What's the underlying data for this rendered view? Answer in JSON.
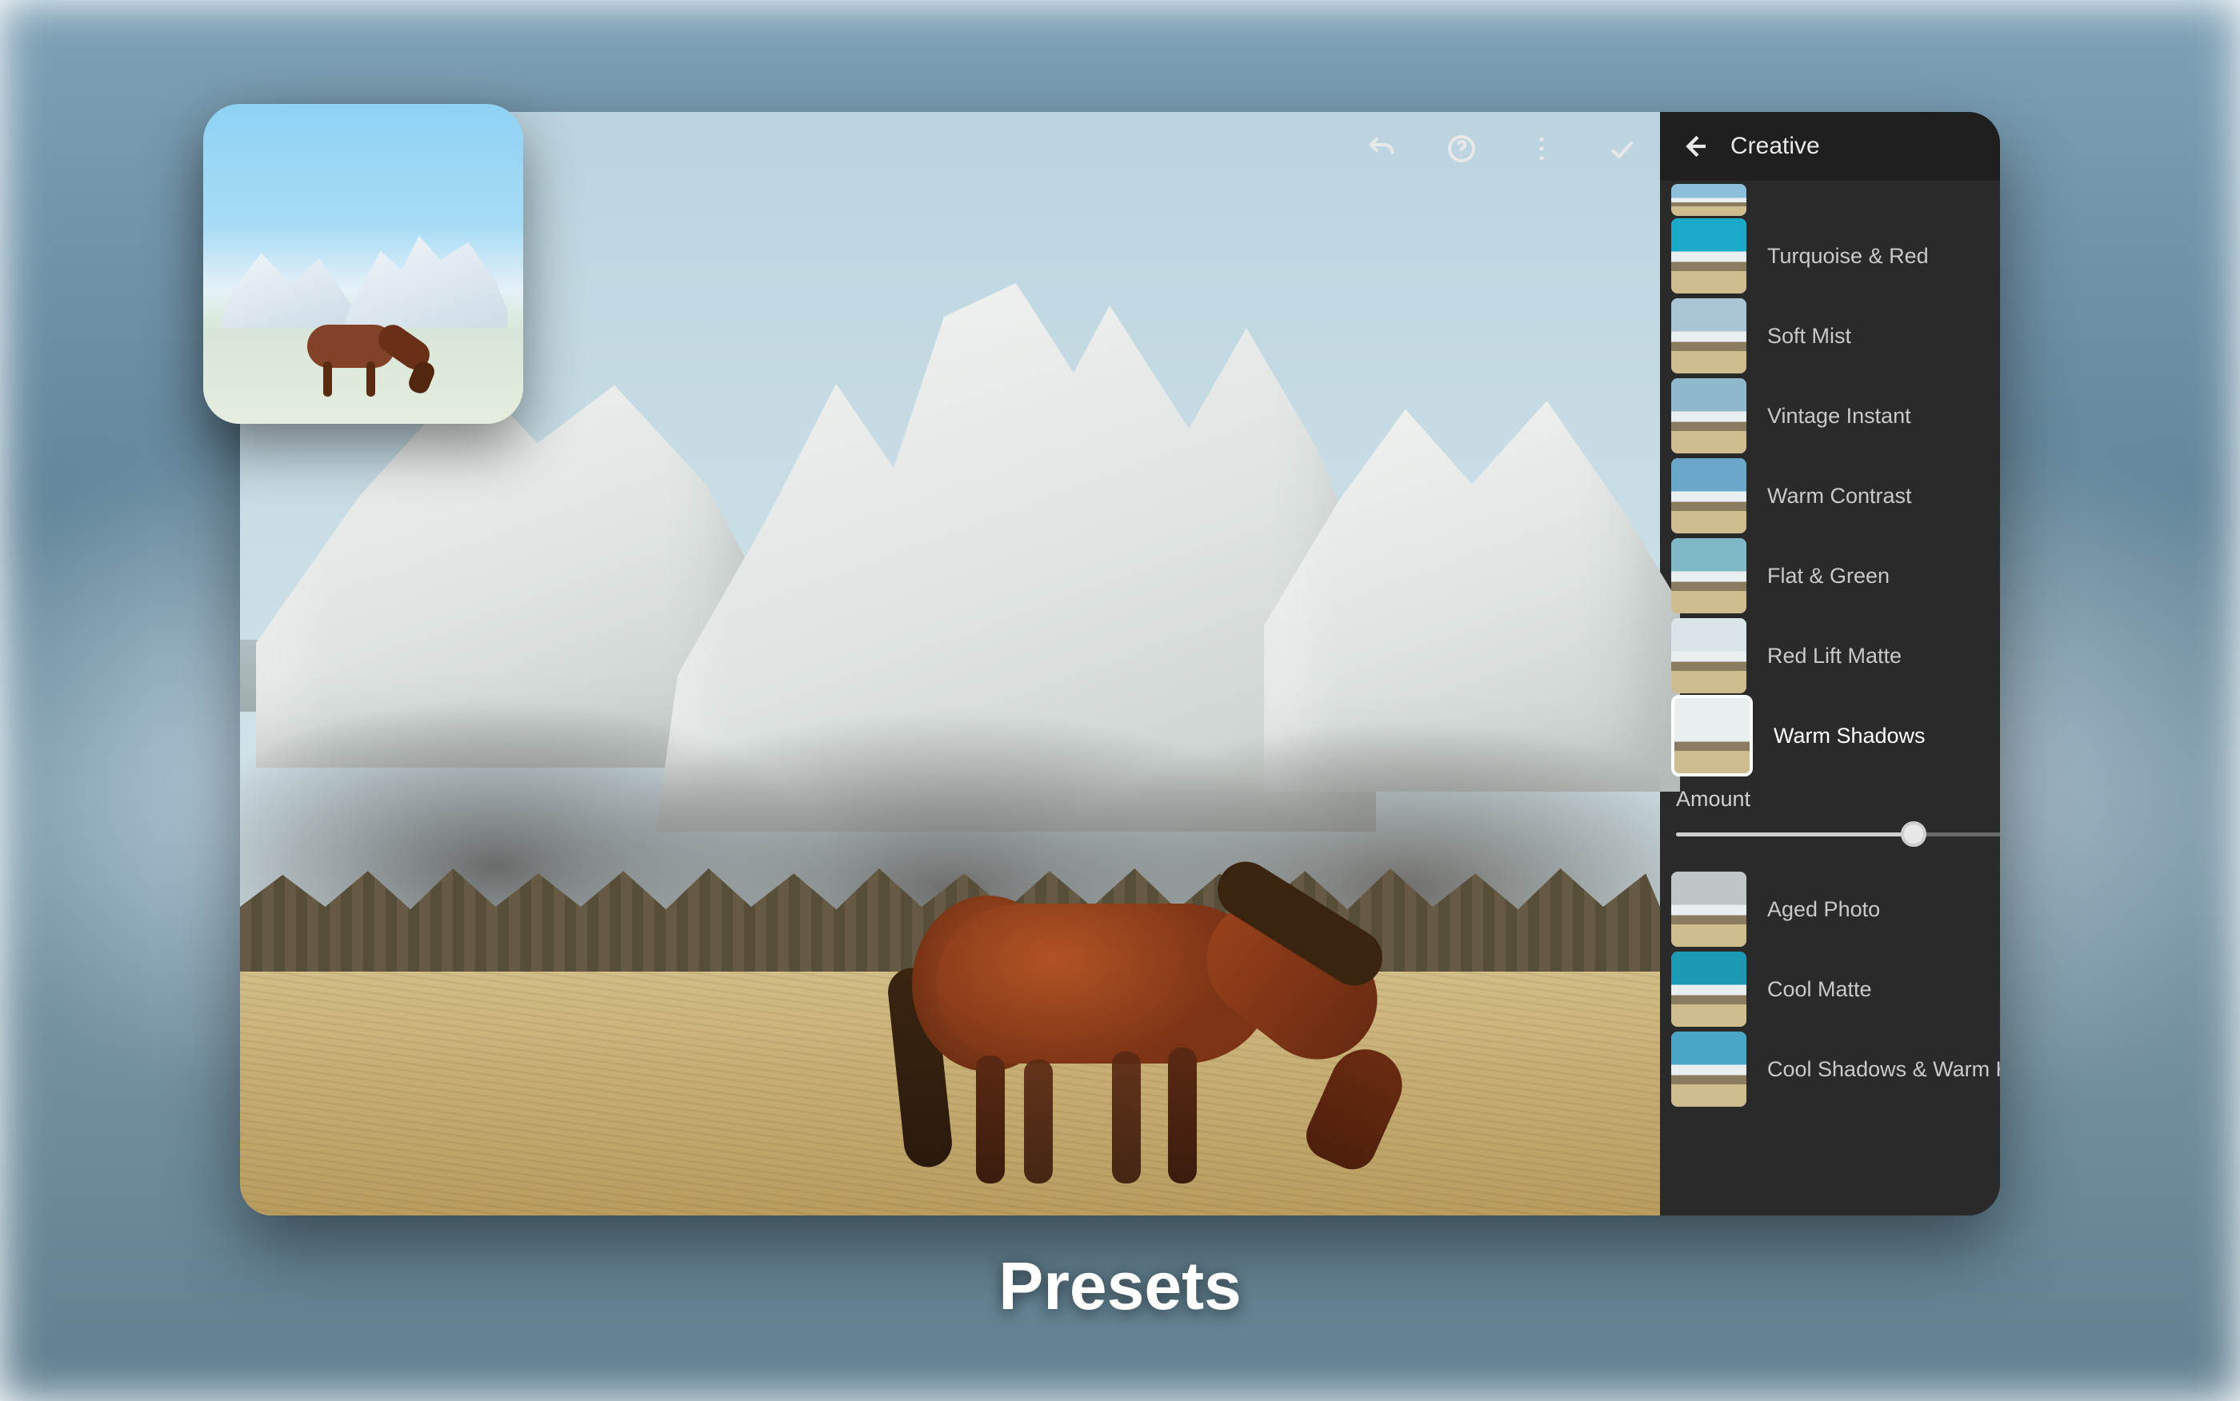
{
  "caption": "Presets",
  "toolbar": {
    "undo_icon": "undo-icon",
    "help_icon": "help-icon",
    "more_icon": "more-vertical-icon",
    "confirm_icon": "check-icon"
  },
  "panel": {
    "back_icon": "back-arrow-icon",
    "title": "Creative",
    "presets": [
      {
        "name": "",
        "sky": "#8cbfda",
        "partial": true
      },
      {
        "name": "Turquoise & Red",
        "sky": "#1aa9c8"
      },
      {
        "name": "Soft Mist",
        "sky": "#a9c4d2"
      },
      {
        "name": "Vintage Instant",
        "sky": "#8fb7cd"
      },
      {
        "name": "Warm Contrast",
        "sky": "#6aa7c9"
      },
      {
        "name": "Flat & Green",
        "sky": "#7fb8c6"
      },
      {
        "name": "Red Lift Matte",
        "sky": "#d9e5e8"
      },
      {
        "name": "Warm Shadows",
        "sky": "#e9efef",
        "selected": true
      },
      {
        "name": "Aged Photo",
        "sky": "#bfc6c5"
      },
      {
        "name": "Cool Matte",
        "sky": "#1e99b5"
      },
      {
        "name": "Cool Shadows & Warm Highlights",
        "sky": "#4aa6c6"
      }
    ],
    "slider": {
      "label": "Amount",
      "value": 116,
      "min": 0,
      "max": 200
    }
  }
}
